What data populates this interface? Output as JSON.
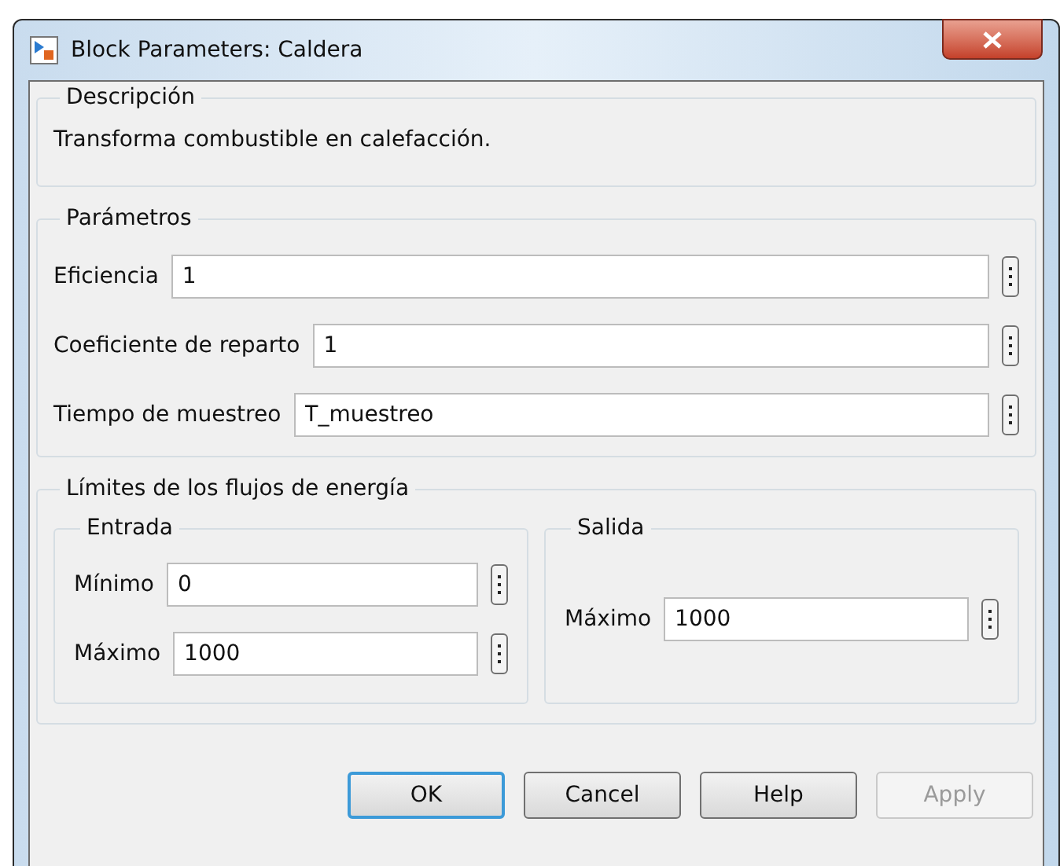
{
  "window": {
    "title": "Block Parameters: Caldera"
  },
  "description": {
    "title": "Descripción",
    "text": "Transforma combustible en calefacción."
  },
  "parameters": {
    "title": "Parámetros",
    "fields": [
      {
        "label": "Eficiencia",
        "value": "1"
      },
      {
        "label": "Coeficiente de reparto",
        "value": "1"
      },
      {
        "label": "Tiempo de muestreo",
        "value": "T_muestreo"
      }
    ]
  },
  "limits": {
    "title": "Límites de los flujos de energía",
    "groups": [
      {
        "title": "Entrada",
        "fields": [
          {
            "label": "Mínimo",
            "value": "0"
          },
          {
            "label": "Máximo",
            "value": "1000"
          }
        ]
      },
      {
        "title": "Salida",
        "fields": [
          {
            "label": "Máximo",
            "value": "1000"
          }
        ]
      }
    ]
  },
  "buttons": [
    {
      "label": "OK",
      "default": true,
      "disabled": false
    },
    {
      "label": "Cancel",
      "default": false,
      "disabled": false
    },
    {
      "label": "Help",
      "default": false,
      "disabled": false
    },
    {
      "label": "Apply",
      "default": false,
      "disabled": true
    }
  ]
}
